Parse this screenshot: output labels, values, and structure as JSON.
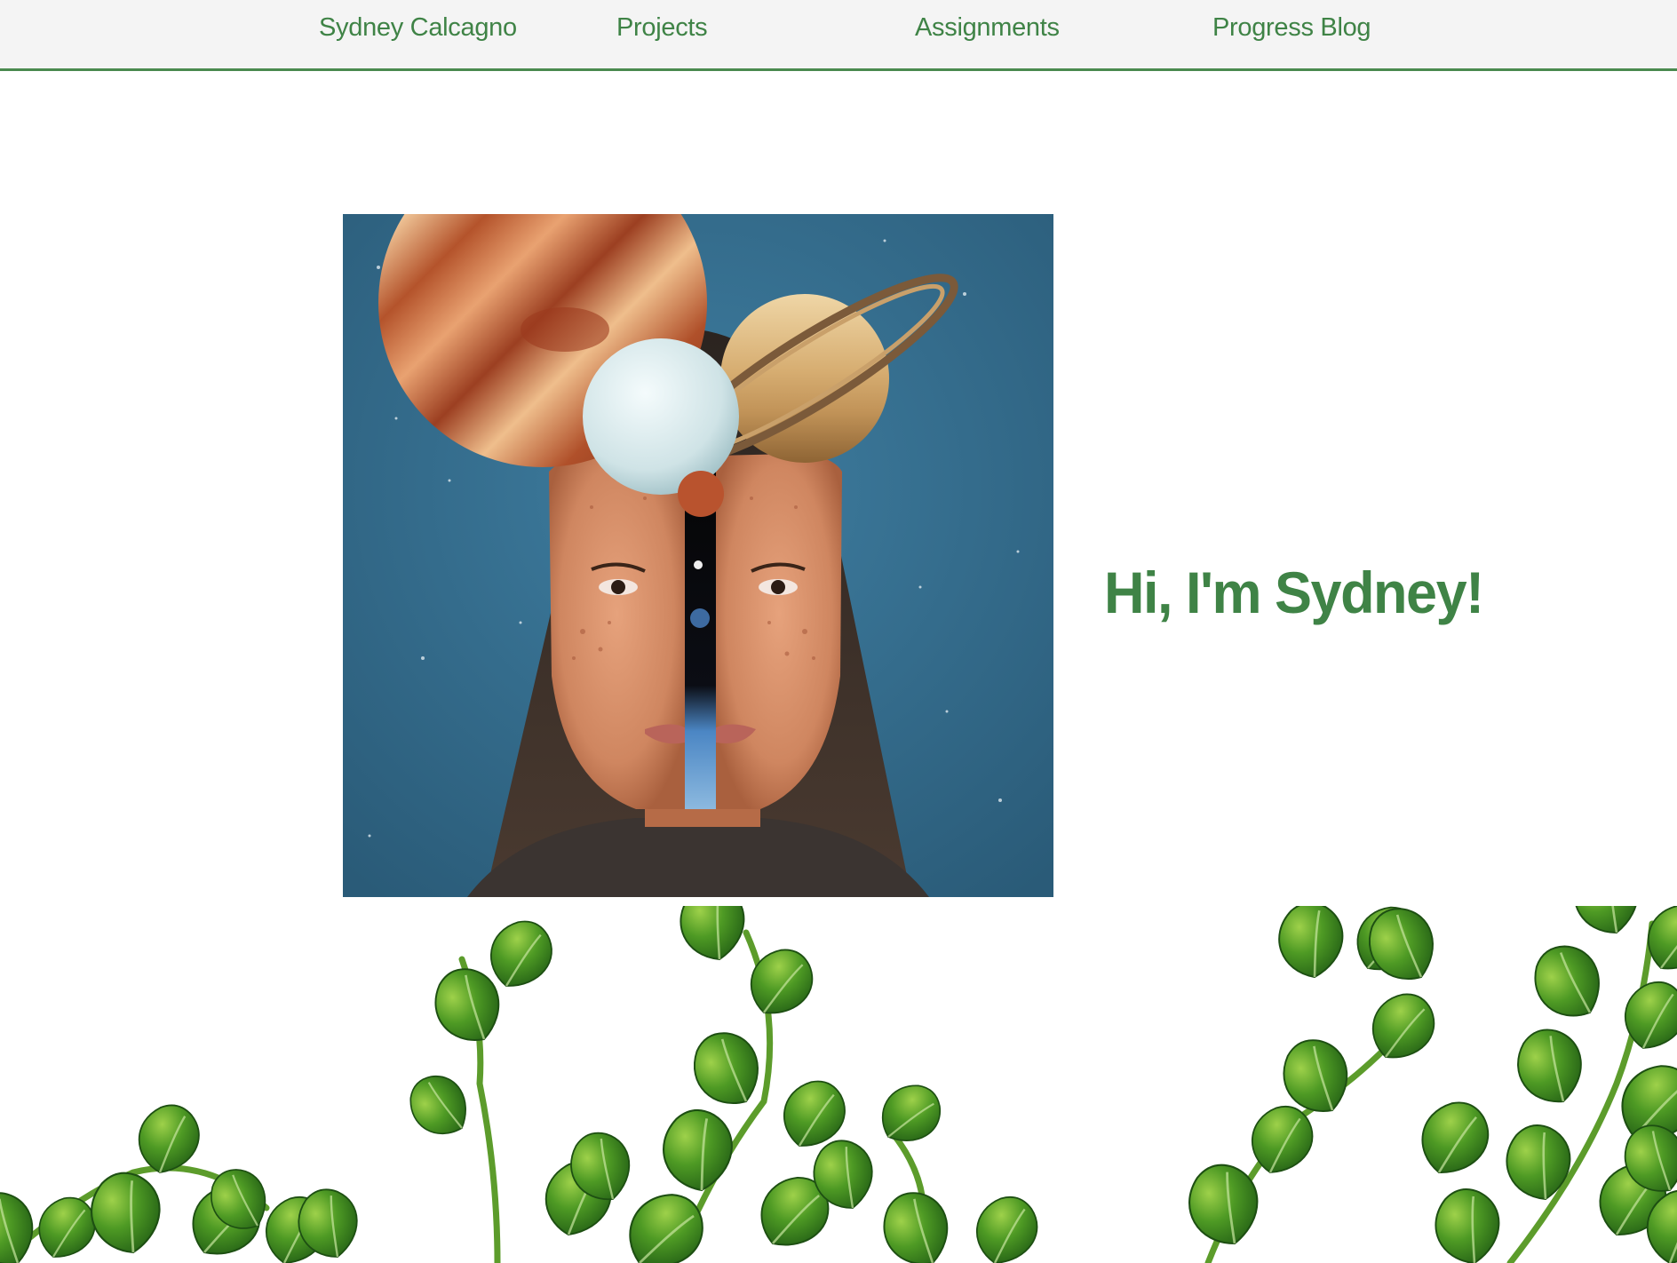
{
  "nav": {
    "brand": "Sydney Calcagno",
    "items": [
      {
        "label": "Projects"
      },
      {
        "label": "Assignments"
      },
      {
        "label": "Progress Blog"
      }
    ]
  },
  "hero": {
    "greeting": "Hi, I'm Sydney!",
    "image_icon": "space-collage-portrait"
  },
  "decor": {
    "icon": "ivy-vines-border",
    "leaf_color": "#4d8f2a",
    "accent_color": "#3f8346"
  }
}
